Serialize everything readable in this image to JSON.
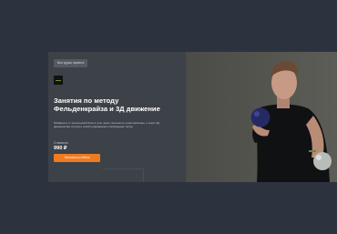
{
  "course": {
    "back_label": "Все курсы проекта",
    "title": "Занятия по методу Фельденкрайза и 3Д движение",
    "description": "Избавьтесь от хронической боли в теле через телесность и расслабление, а через 3Д движение Вы получите собой подвижными и свободными телом.",
    "price_label": "Стоимость",
    "price_value": "990 ₽",
    "cta_label": "Записаться сейчас"
  },
  "colors": {
    "page_background": "#2d333e",
    "panel": "#3d4148",
    "accent": "#ee7b22"
  },
  "icons": {
    "logo": "brand-logo-icon"
  },
  "media": {
    "hero": "man-holding-two-balls"
  }
}
